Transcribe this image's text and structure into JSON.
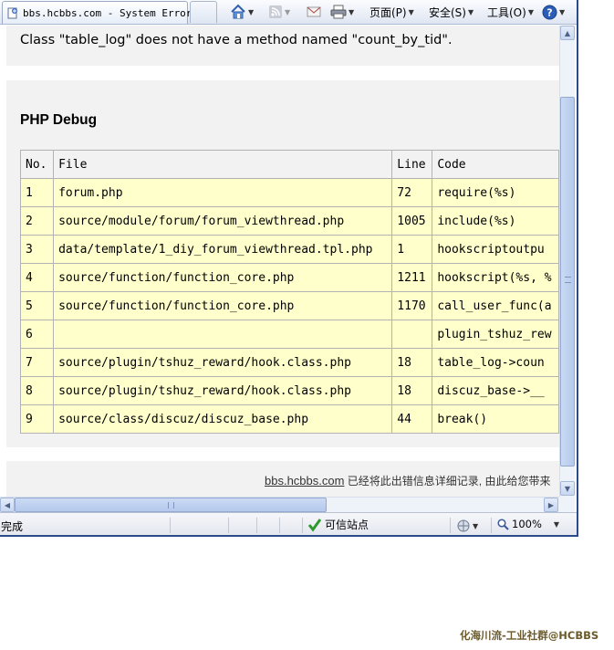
{
  "browser": {
    "tab_title": "bbs.hcbbs.com - System Error",
    "toolbar": {
      "page_label": "页面(P)",
      "safety_label": "安全(S)",
      "tools_label": "工具(O)"
    }
  },
  "error": {
    "message": "Class \"table_log\" does not have a method named \"count_by_tid\"."
  },
  "debug": {
    "title": "PHP Debug",
    "headers": [
      "No.",
      "File",
      "Line",
      "Code"
    ],
    "rows": [
      {
        "no": "1",
        "file": "forum.php",
        "line": "72",
        "code": "require(%s)"
      },
      {
        "no": "2",
        "file": "source/module/forum/forum_viewthread.php",
        "line": "1005",
        "code": "include(%s)"
      },
      {
        "no": "3",
        "file": "data/template/1_diy_forum_viewthread.tpl.php",
        "line": "1",
        "code": "hookscriptoutpu"
      },
      {
        "no": "4",
        "file": "source/function/function_core.php",
        "line": "1211",
        "code": "hookscript(%s, %"
      },
      {
        "no": "5",
        "file": "source/function/function_core.php",
        "line": "1170",
        "code": "call_user_func(a"
      },
      {
        "no": "6",
        "file": "",
        "line": "",
        "code": "plugin_tshuz_rew"
      },
      {
        "no": "7",
        "file": "source/plugin/tshuz_reward/hook.class.php",
        "line": "18",
        "code": "table_log->coun"
      },
      {
        "no": "8",
        "file": "source/plugin/tshuz_reward/hook.class.php",
        "line": "18",
        "code": "discuz_base->__"
      },
      {
        "no": "9",
        "file": "source/class/discuz/discuz_base.php",
        "line": "44",
        "code": "break()"
      }
    ]
  },
  "footer": {
    "link": "bbs.hcbbs.com",
    "text": " 已经将此出错信息详细记录, 由此给您带来"
  },
  "status": {
    "text": "完成",
    "zone": "可信站点",
    "zoom": "100%"
  },
  "watermark": "化海川流-工业社群@HCBBS"
}
